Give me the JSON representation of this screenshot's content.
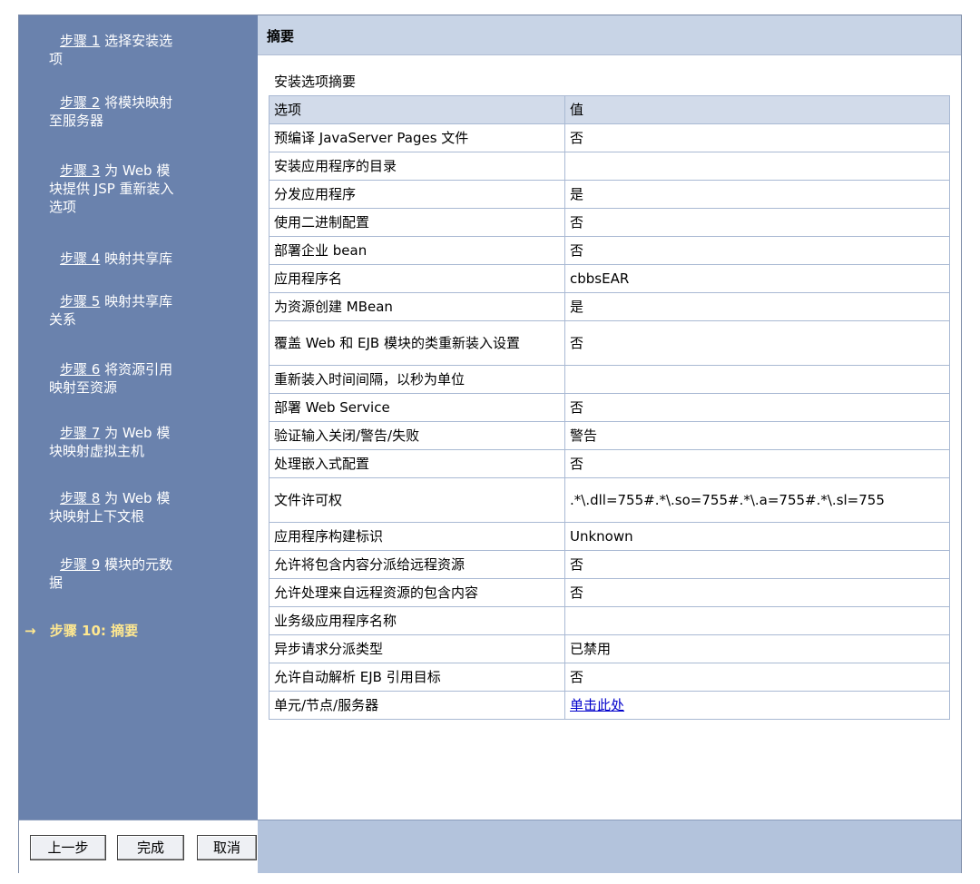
{
  "steps": [
    {
      "link": "步骤 1",
      "rest": "选择安装选",
      "wrap": "项"
    },
    {
      "link": "步骤 2",
      "rest": "将模块映射",
      "wrap": "至服务器"
    },
    {
      "link": "步骤 3",
      "rest": "为 Web 模",
      "wrap": "块提供 JSP 重新装入",
      "wrap2": "选项"
    },
    {
      "link": "步骤 4",
      "rest": "映射共享库",
      "wrap": ""
    },
    {
      "link": "步骤 5",
      "rest": "映射共享库",
      "wrap": "关系"
    },
    {
      "link": "步骤 6",
      "rest": "将资源引用",
      "wrap": "映射至资源"
    },
    {
      "link": "步骤 7",
      "rest": "为 Web 模",
      "wrap": "块映射虚拟主机"
    },
    {
      "link": "步骤 8",
      "rest": "为 Web 模",
      "wrap": "块映射上下文根"
    },
    {
      "link": "步骤 9",
      "rest": "模块的元数",
      "wrap": "据"
    }
  ],
  "current_step": {
    "arrow": "→",
    "label": "步骤 10: 摘要"
  },
  "summary": {
    "title": "摘要",
    "subtitle": "安装选项摘要",
    "headers": {
      "option": "选项",
      "value": "值"
    },
    "rows": [
      {
        "option": "预编译 JavaServer Pages 文件",
        "value": "否"
      },
      {
        "option": "安装应用程序的目录",
        "value": ""
      },
      {
        "option": "分发应用程序",
        "value": "是"
      },
      {
        "option": "使用二进制配置",
        "value": "否"
      },
      {
        "option": "部署企业 bean",
        "value": "否"
      },
      {
        "option": "应用程序名",
        "value": "cbbsEAR"
      },
      {
        "option": "为资源创建 MBean",
        "value": "是"
      },
      {
        "option": "覆盖 Web 和 EJB 模块的类重新装入设置",
        "value": "否"
      },
      {
        "option": "重新装入时间间隔，以秒为单位",
        "value": ""
      },
      {
        "option": "部署 Web Service",
        "value": "否"
      },
      {
        "option": "验证输入关闭/警告/失败",
        "value": "警告"
      },
      {
        "option": "处理嵌入式配置",
        "value": "否"
      },
      {
        "option": "文件许可权",
        "value": ".*\\.dll=755#.*\\.so=755#.*\\.a=755#.*\\.sl=755"
      },
      {
        "option": "应用程序构建标识",
        "value": "Unknown"
      },
      {
        "option": "允许将包含内容分派给远程资源",
        "value": "否"
      },
      {
        "option": "允许处理来自远程资源的包含内容",
        "value": "否"
      },
      {
        "option": "业务级应用程序名称",
        "value": ""
      },
      {
        "option": "异步请求分派类型",
        "value": "已禁用"
      },
      {
        "option": "允许自动解析 EJB 引用目标",
        "value": "否"
      },
      {
        "option": "单元/节点/服务器",
        "value": "单击此处"
      }
    ]
  },
  "buttons": {
    "previous": "上一步",
    "finish": "完成",
    "cancel": "取消"
  },
  "colors": {
    "sidebar": "#6a82ad",
    "header": "#c8d4e6",
    "current_step": "#ffe890",
    "link": "#0000cc"
  }
}
